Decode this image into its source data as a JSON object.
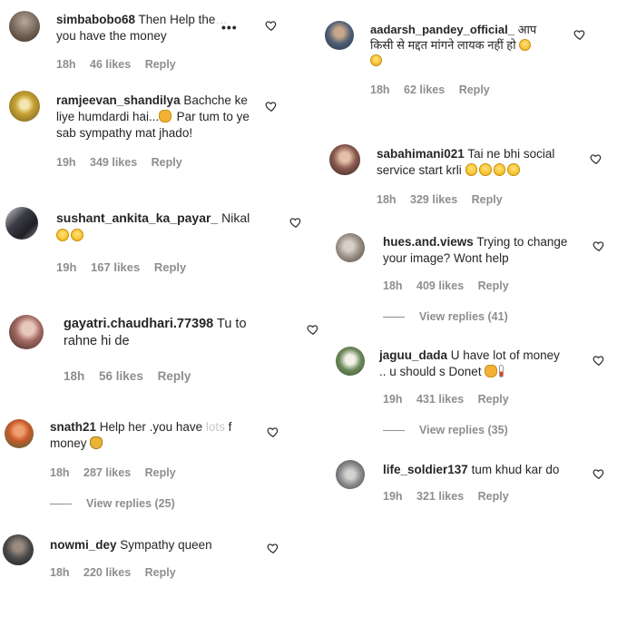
{
  "left": [
    {
      "username": "simbabobo68",
      "text": "Then Help the",
      "text_faded": "…",
      "text2": "you have the money",
      "time": "18h",
      "likes": "46 likes",
      "reply": "Reply",
      "avatar_color": "#7a6a5c"
    },
    {
      "username": "ramjeevan_shandilya",
      "text": "Bachche ke liye humdardi hai...",
      "text2": "Par tum to ye sab sympathy mat jhado!",
      "time": "19h",
      "likes": "349 likes",
      "reply": "Reply",
      "avatar_color": "#c9a436"
    },
    {
      "username": "sushant_ankita_ka_payar_",
      "text": "Nikal",
      "time": "19h",
      "likes": "167 likes",
      "reply": "Reply",
      "avatar_color": "#3c3c46"
    },
    {
      "username": "gayatri.chaudhari.77398",
      "text": "Tu to",
      "text2": "rahne hi de",
      "time": "18h",
      "likes": "56 likes",
      "reply": "Reply",
      "avatar_color": "#b48a84"
    },
    {
      "username": "snath21",
      "text": "Help her .you have",
      "text_faded": "lots",
      "text3": "f",
      "text2": "money",
      "time": "18h",
      "likes": "287 likes",
      "reply": "Reply",
      "view_replies": "View replies (25)",
      "avatar_color": "#c85a2c"
    },
    {
      "username": "nowmi_dey",
      "text": "Sympathy queen",
      "time": "18h",
      "likes": "220 likes",
      "reply": "Reply",
      "avatar_color": "#4a4a4a"
    }
  ],
  "right": [
    {
      "username": "aadarsh_pandey_official_",
      "text": "आप",
      "text2": "किसी से मद्दत मांगने लायक नहीं हो",
      "time": "18h",
      "likes": "62 likes",
      "reply": "Reply",
      "avatar_color": "#4f5e74"
    },
    {
      "username": "sabahimani021",
      "text": "Tai ne bhi social",
      "text2": "service start krli",
      "time": "18h",
      "likes": "329 likes",
      "reply": "Reply",
      "avatar_color": "#8a5a50"
    },
    {
      "username": "hues.and.views",
      "text": "Trying to change",
      "text2": "your image? Wont help",
      "time": "18h",
      "likes": "409 likes",
      "reply": "Reply",
      "view_replies": "View replies (41)",
      "avatar_color": "#9a8f86"
    },
    {
      "username": "jaguu_dada",
      "text": "U have lot of money",
      "text2": ".. u should s Donet",
      "time": "19h",
      "likes": "431 likes",
      "reply": "Reply",
      "view_replies": "View replies (35)",
      "avatar_color": "#6d8a5a"
    },
    {
      "username": "life_soldier137",
      "text": "tum khud kar do",
      "time": "19h",
      "likes": "321 likes",
      "reply": "Reply",
      "avatar_color": "#8e8f90"
    }
  ],
  "icons": {
    "like": "heart-outline-icon",
    "ellipsis": "more-options-icon"
  }
}
